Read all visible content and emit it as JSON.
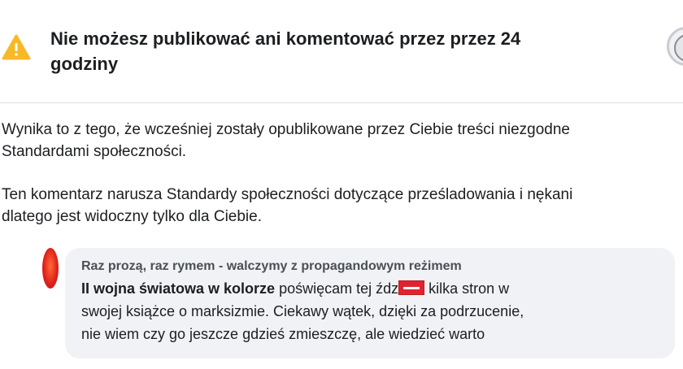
{
  "header": {
    "icon": "warning-icon",
    "title_line1": "Nie możesz publikować ani komentować przez przez 24",
    "title_line2": "godziny"
  },
  "body": {
    "paragraph1_line1": "Wynika to z tego, że wcześniej zostały opublikowane przez Ciebie treści niezgodne",
    "paragraph1_line2": "Standardami społeczności.",
    "paragraph2_line1": "Ten komentarz narusza Standardy społeczności dotyczące prześladowania i nękani",
    "paragraph2_line2": "dlatego jest widoczny tylko dla Ciebie."
  },
  "comment": {
    "author": "Raz prozą, raz rymem - walczymy z propagandowym reżimem",
    "tag": "II wojna światowa w kolorze",
    "line1_a": " poświęcam tej źdz",
    "line1_b": " kilka stron w",
    "line2": "swojej książce o marksizmie. Ciekawy wątek, dzięki za podrzucenie,",
    "line3": "nie wiem czy go jeszcze gdzieś zmieszczę, ale wiedzieć warto"
  },
  "colors": {
    "warning": "#f7b928",
    "redaction": "#e0242e",
    "bubble": "#f0f2f5"
  }
}
